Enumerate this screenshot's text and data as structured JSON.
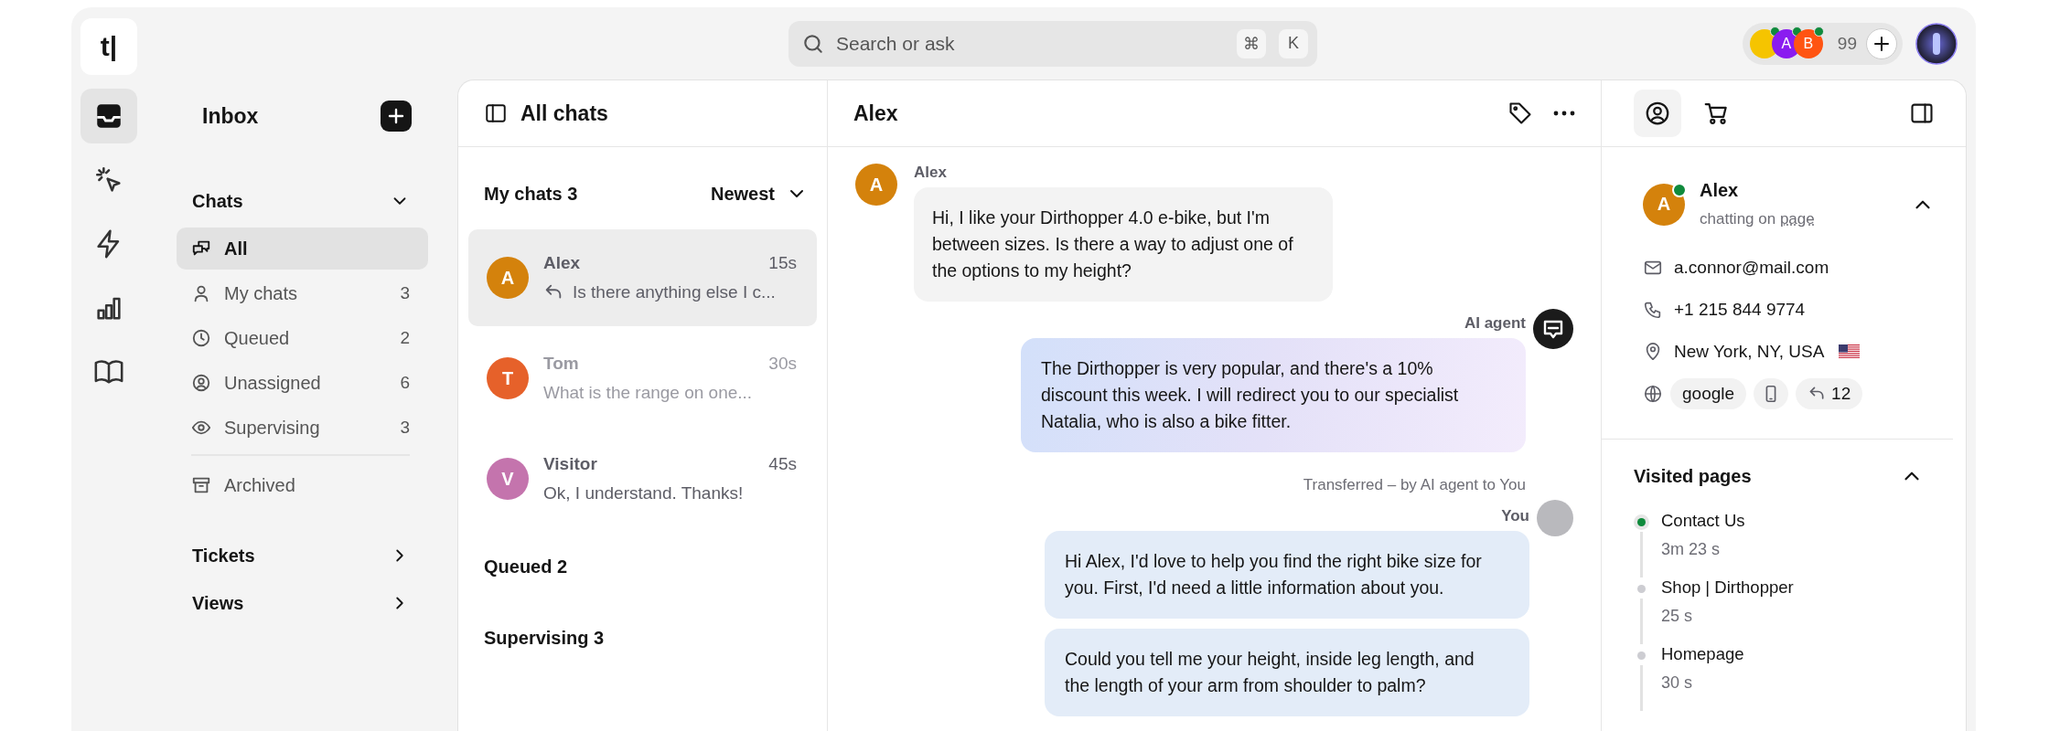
{
  "top_bar": {
    "logo": "t|",
    "search": {
      "placeholder": "Search or ask",
      "shortcut_keys": [
        "⌘",
        "K"
      ]
    },
    "agents": {
      "avatars": [
        {
          "kind": "photo",
          "color": "#f5c400",
          "online": true
        },
        {
          "kind": "letter",
          "label": "A",
          "color": "#8a1cf0",
          "online": true
        },
        {
          "kind": "letter",
          "label": "B",
          "color": "#ff5412",
          "online": true
        }
      ],
      "count": "99"
    }
  },
  "rail": {
    "items": [
      {
        "kind": "inbox",
        "selected": true
      },
      {
        "kind": "cursor",
        "selected": false
      },
      {
        "kind": "bolt",
        "selected": false
      },
      {
        "kind": "chart",
        "selected": false
      },
      {
        "kind": "book",
        "selected": false
      }
    ]
  },
  "inbox": {
    "title": "Inbox",
    "sections": [
      {
        "title": "Chats",
        "expanded": true,
        "items": [
          {
            "kind": "chats",
            "label": "All",
            "selected": true
          },
          {
            "kind": "person",
            "label": "My chats",
            "count": "3",
            "selected": false
          },
          {
            "kind": "clock",
            "label": "Queued",
            "count": "2",
            "selected": false
          },
          {
            "kind": "user-circle",
            "label": "Unassigned",
            "count": "6",
            "selected": false
          },
          {
            "kind": "eye",
            "label": "Supervising",
            "count": "3",
            "selected": false
          }
        ],
        "footer_items": [
          {
            "kind": "archive",
            "label": "Archived",
            "selected": false
          }
        ]
      },
      {
        "title": "Tickets",
        "expanded": false
      },
      {
        "title": "Views",
        "expanded": false
      }
    ]
  },
  "chat_list": {
    "title": "All chats",
    "groups": [
      {
        "title": "My chats 3",
        "sort": "Newest",
        "chats": [
          {
            "name": "Alex",
            "avatar": "A",
            "color": "#d4820c",
            "time": "15s",
            "preview": "Is there anything else I c...",
            "replied": true,
            "dimmed": false,
            "selected": true
          },
          {
            "name": "Tom",
            "avatar": "T",
            "color": "#e6612a",
            "time": "30s",
            "preview": "What is the range on one...",
            "replied": false,
            "dimmed": true,
            "selected": false
          },
          {
            "name": "Visitor",
            "avatar": "V",
            "color": "#c474ad",
            "time": "45s",
            "preview": "Ok, I understand. Thanks!",
            "replied": false,
            "dimmed": false,
            "selected": false
          }
        ]
      },
      {
        "title": "Queued 2"
      },
      {
        "title": "Supervising 3"
      }
    ]
  },
  "conversation": {
    "title": "Alex",
    "messages": [
      {
        "kind": "incoming",
        "author": "Alex",
        "avatar": "A",
        "color": "#d4820c",
        "bubbles": [
          "Hi, I like your Dirthopper 4.0 e-bike, but I'm between sizes. Is there a way to adjust one of the options to my height?"
        ]
      },
      {
        "kind": "bot",
        "author": "AI agent",
        "bubbles": [
          "The Dirthopper is very popular, and there's a 10% discount this week. I will redirect you to our specialist Natalia, who is also a bike fitter."
        ]
      },
      {
        "kind": "event",
        "text": "Transferred – by AI agent to You"
      },
      {
        "kind": "outgoing",
        "author": "You",
        "bubbles": [
          "Hi Alex, I'd love to help you find the right bike size for you. First, I'd need a little information about you.",
          "Could you tell me your height, inside leg length, and the length of your arm from shoulder to palm?"
        ]
      }
    ]
  },
  "details": {
    "tabs": [
      {
        "kind": "profile",
        "selected": true
      },
      {
        "kind": "cart",
        "selected": false
      }
    ],
    "contact": {
      "name": "Alex",
      "avatar": "A",
      "color": "#d4820c",
      "online": true,
      "status": "chatting on",
      "status_link": "page",
      "expanded": true,
      "rows": [
        {
          "kind": "email",
          "text": "a.connor@mail.com"
        },
        {
          "kind": "phone",
          "text": "+1 215 844 9774"
        },
        {
          "kind": "location",
          "text": "New York, NY, USA",
          "has_flag": true
        }
      ],
      "chips": [
        {
          "kind": "source",
          "text": "google"
        },
        {
          "kind": "device"
        },
        {
          "kind": "returns",
          "text": "12"
        }
      ]
    },
    "visited_pages": {
      "title": "Visited pages",
      "expanded": true,
      "pages": [
        {
          "title": "Contact Us",
          "duration": "3m 23 s",
          "current": true
        },
        {
          "title": "Shop | Dirthopper",
          "duration": "25 s",
          "current": false
        },
        {
          "title": "Homepage",
          "duration": "30 s",
          "current": false
        }
      ]
    }
  }
}
